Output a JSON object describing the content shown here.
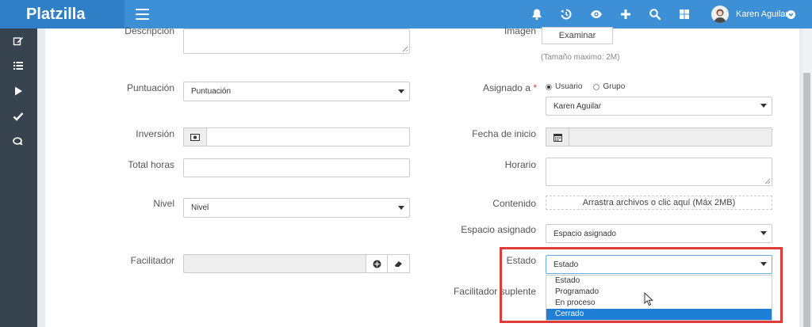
{
  "app": {
    "brand": "Platzilla"
  },
  "user": {
    "name": "Karen Aguilar"
  },
  "form": {
    "descripcion_label": "Descripción",
    "imagen_label": "Imagen",
    "examinar_button": "Examinar",
    "imagen_hint": "(Tamaño maximo: 2M)",
    "puntuacion_label": "Puntuación",
    "puntuacion_value": "Puntuación",
    "asignado_label": "Asignado a",
    "asignado_required": "*",
    "radio_usuario": "Usuario",
    "radio_grupo": "Grupo",
    "asignado_value": "Karen Aguilar",
    "inversion_label": "Inversión",
    "fecha_inicio_label": "Fecha de inicio",
    "total_horas_label": "Total horas",
    "horario_label": "Horario",
    "nivel_label": "Nivel",
    "nivel_value": "Nivel",
    "contenido_label": "Contenido",
    "contenido_dropzone": "Arrastra archivos o clic aquí (Máx 2MB)",
    "espacio_label": "Espacio asignado",
    "espacio_value": "Espacio asignado",
    "facilitador_label": "Facilitador",
    "estado_label": "Estado",
    "estado_value": "Estado",
    "facilitador_suplente_label": "Facilitador suplente",
    "estado_options": [
      "Estado",
      "Programado",
      "En proceso",
      "Cerrado"
    ],
    "estado_highlighted": "Cerrado"
  },
  "colors": {
    "topbar": "#3d8fd6",
    "brand_bg": "#2f7fc7",
    "sidebar": "#37434f",
    "highlight": "#e03b3b",
    "selected_option": "#1f7ed6"
  }
}
